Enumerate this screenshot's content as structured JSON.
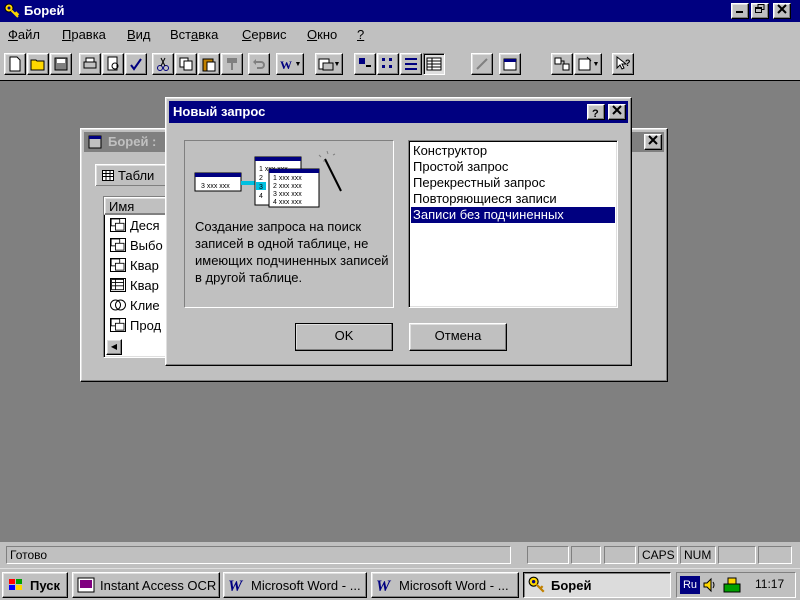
{
  "app": {
    "title": "Борей"
  },
  "menu": [
    {
      "label": "Файл",
      "u": "Ф",
      "rest": "айл"
    },
    {
      "label": "Правка",
      "u": "П",
      "rest": "равка"
    },
    {
      "label": "Вид",
      "u": "В",
      "rest": "ид"
    },
    {
      "label": "Вставка",
      "pre": "Вст",
      "u": "а",
      "rest": "вка"
    },
    {
      "label": "Сервис",
      "u": "С",
      "rest": "ервис"
    },
    {
      "label": "Окно",
      "u": "О",
      "rest": "кно"
    },
    {
      "label": "?",
      "u": "?",
      "rest": ""
    }
  ],
  "db_window": {
    "title": "Борей :",
    "tab": "Табли",
    "column_header": "Имя",
    "rows": [
      "Деся",
      "Выбо",
      "Квар",
      "Квар",
      "Клие",
      "Прод"
    ]
  },
  "dialog": {
    "title": "Новый запрос",
    "help_label": "?",
    "description": "Создание запроса на поиск записей в одной таблице, не имеющих подчиненных записей в другой таблице.",
    "illustration": {
      "left_row": "3 xxx xxx",
      "right_rows": [
        "1 xxx xxx",
        "2",
        "3",
        "4"
      ],
      "front_rows": [
        "1 xxx xxx",
        "2 xxx xxx",
        "3 xxx xxx",
        "4 xxx xxx"
      ]
    },
    "options": [
      "Конструктор",
      "Простой запрос",
      "Перекрестный запрос",
      "Повторяющиеся записи",
      "Записи без подчиненных"
    ],
    "selected_index": 4,
    "ok_label": "OK",
    "cancel_label": "Отмена"
  },
  "status": {
    "text": "Готово",
    "caps": "CAPS",
    "num": "NUM"
  },
  "taskbar": {
    "start": "Пуск",
    "tasks": [
      "Instant Access OCR",
      "Microsoft Word - ...",
      "Microsoft Word - ...",
      "Борей"
    ],
    "active_index": 3,
    "lang": "Ru",
    "clock": "11:17"
  },
  "colors": {
    "title_active": "#000080",
    "title_inactive": "#808080",
    "workspace": "#808080",
    "face": "#c0c0c0",
    "selection": "#000080"
  }
}
